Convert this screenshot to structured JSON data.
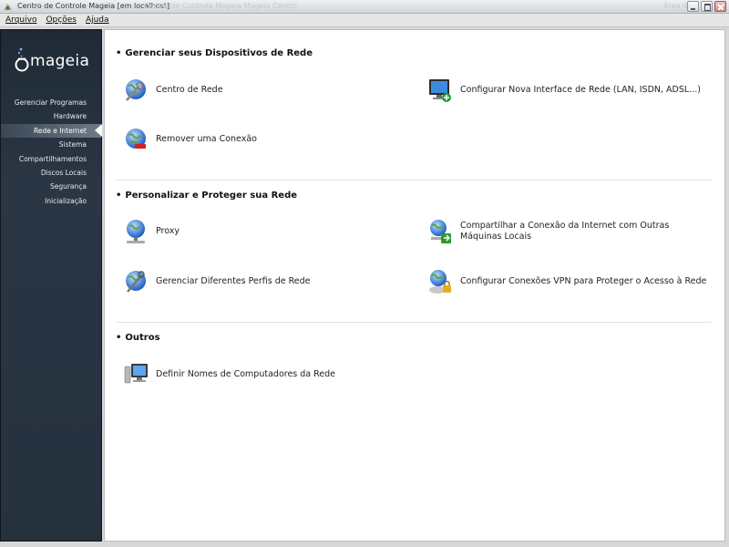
{
  "window": {
    "title": "Centro de Controle Mageia  [em localhost]",
    "ghost_title": "Centro de Controle Mageia  Mageia Centro",
    "ghost_right": "Área de"
  },
  "menubar": {
    "items": [
      {
        "label": "Arquivo"
      },
      {
        "label": "Opções"
      },
      {
        "label": "Ajuda"
      }
    ]
  },
  "sidebar": {
    "logo_text": "mageia",
    "items": [
      {
        "label": "Gerenciar Programas",
        "active": false
      },
      {
        "label": "Hardware",
        "active": false
      },
      {
        "label": "Rede e Internet",
        "active": true
      },
      {
        "label": "Sistema",
        "active": false
      },
      {
        "label": "Compartilhamentos",
        "active": false
      },
      {
        "label": "Discos Locais",
        "active": false
      },
      {
        "label": "Segurança",
        "active": false
      },
      {
        "label": "Inicialização",
        "active": false
      }
    ]
  },
  "sections": [
    {
      "title": "Gerenciar seus Dispositivos de Rede",
      "items": [
        {
          "label": "Centro de Rede",
          "icon": "network-center-icon"
        },
        {
          "label": "Configurar Nova Interface de Rede (LAN, ISDN, ADSL...)",
          "icon": "monitor-add-icon"
        },
        {
          "label": "Remover uma Conexão",
          "icon": "globe-remove-icon"
        }
      ]
    },
    {
      "title": "Personalizar e Proteger sua Rede",
      "items": [
        {
          "label": "Proxy",
          "icon": "globe-proxy-icon"
        },
        {
          "label": "Compartilhar a Conexão da Internet com Outras Máquinas Locais",
          "icon": "globe-share-icon"
        },
        {
          "label": "Gerenciar Diferentes Perfis de Rede",
          "icon": "globe-profiles-icon"
        },
        {
          "label": "Configurar Conexões VPN para Proteger o Acesso à Rede",
          "icon": "globe-vpn-icon"
        }
      ]
    },
    {
      "title": "Outros",
      "items": [
        {
          "label": "Definir Nomes de Computadores da Rede",
          "icon": "computer-icon"
        }
      ]
    }
  ],
  "colors": {
    "sidebar_bg": "#26313e",
    "main_bg": "#ffffff",
    "globe_blue": "#2a6fd6"
  }
}
